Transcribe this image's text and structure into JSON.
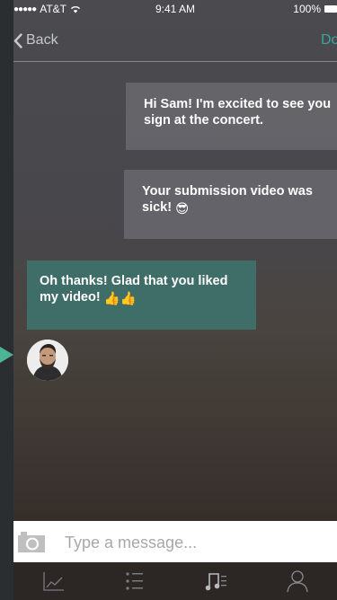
{
  "statusbar": {
    "carrier": "AT&T",
    "time": "9:41 AM",
    "battery": "100%"
  },
  "nav": {
    "back_label": "Back",
    "done_label": "Done"
  },
  "messages": [
    {
      "direction": "outgoing",
      "text": "Hi Sam! I'm excited to see you sign at the concert.",
      "emoji": ""
    },
    {
      "direction": "outgoing",
      "text": "Your submission video was sick!",
      "emoji": "😎"
    },
    {
      "direction": "incoming",
      "text": "Oh thanks! Glad that you liked my video!",
      "emoji": "👍👍"
    }
  ],
  "composer": {
    "placeholder": "Type a message..."
  },
  "tabs": [
    {
      "icon": "chart-icon"
    },
    {
      "icon": "list-icon"
    },
    {
      "icon": "music-icon"
    },
    {
      "icon": "profile-icon"
    }
  ],
  "colors": {
    "accent": "#3aa6a0",
    "incoming_bubble": "#3f6e68",
    "pointer_arrow": "#4bb496"
  }
}
